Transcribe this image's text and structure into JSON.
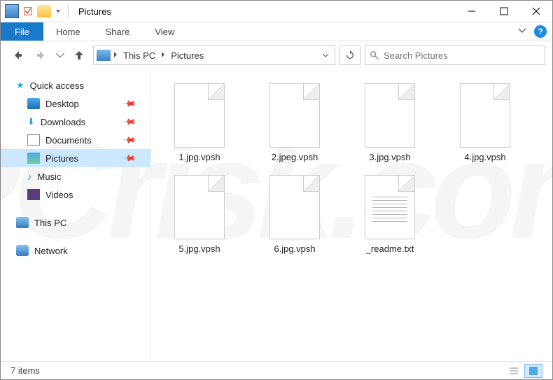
{
  "window": {
    "title": "Pictures"
  },
  "ribbon": {
    "file": "File",
    "tabs": [
      "Home",
      "Share",
      "View"
    ]
  },
  "address": {
    "parts": [
      "This PC",
      "Pictures"
    ]
  },
  "search": {
    "placeholder": "Search Pictures"
  },
  "sidebar": {
    "quick_access": "Quick access",
    "items": [
      {
        "label": "Desktop",
        "pinned": true
      },
      {
        "label": "Downloads",
        "pinned": true
      },
      {
        "label": "Documents",
        "pinned": true
      },
      {
        "label": "Pictures",
        "pinned": true,
        "selected": true
      },
      {
        "label": "Music",
        "pinned": false
      },
      {
        "label": "Videos",
        "pinned": false
      }
    ],
    "this_pc": "This PC",
    "network": "Network"
  },
  "files": [
    {
      "name": "1.jpg.vpsh",
      "type": "file"
    },
    {
      "name": "2.jpeg.vpsh",
      "type": "file"
    },
    {
      "name": "3.jpg.vpsh",
      "type": "file"
    },
    {
      "name": "4.jpg.vpsh",
      "type": "file"
    },
    {
      "name": "5.jpg.vpsh",
      "type": "file"
    },
    {
      "name": "6.jpg.vpsh",
      "type": "file"
    },
    {
      "name": "_readme.txt",
      "type": "txt"
    }
  ],
  "status": {
    "count": "7 items"
  }
}
